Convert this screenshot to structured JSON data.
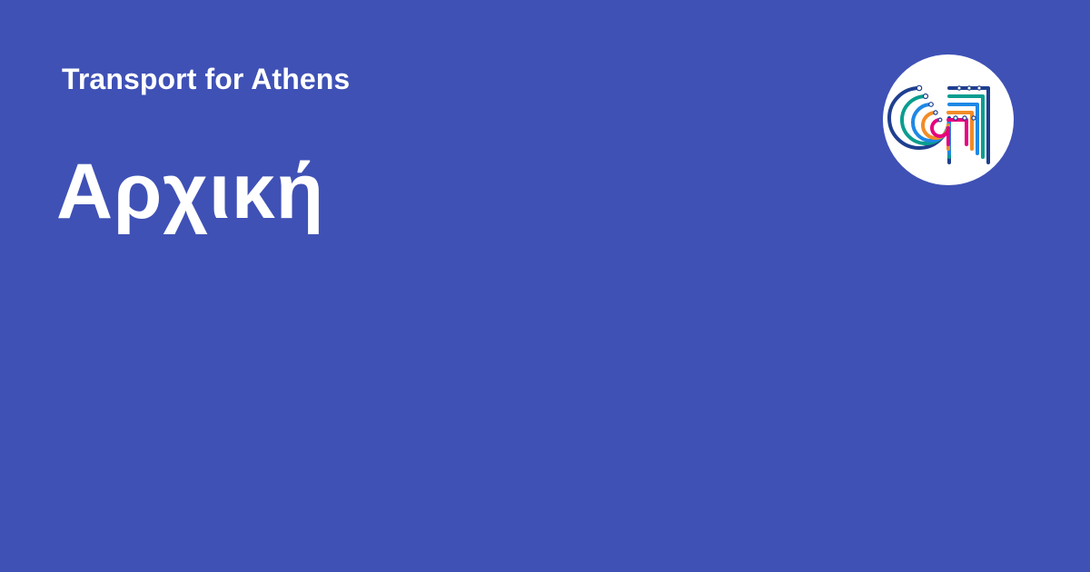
{
  "header": {
    "site_name": "Transport for Athens"
  },
  "page": {
    "title": "Αρχική"
  },
  "logo": {
    "icon": "transport-network-logo-icon",
    "colors": {
      "navy": "#1f3f8f",
      "teal": "#0a9d8f",
      "blue": "#1e88e5",
      "orange": "#f28c28",
      "pink": "#e6007e"
    }
  },
  "theme": {
    "background": "#3f51b5",
    "text": "#ffffff",
    "logo_background": "#ffffff"
  }
}
